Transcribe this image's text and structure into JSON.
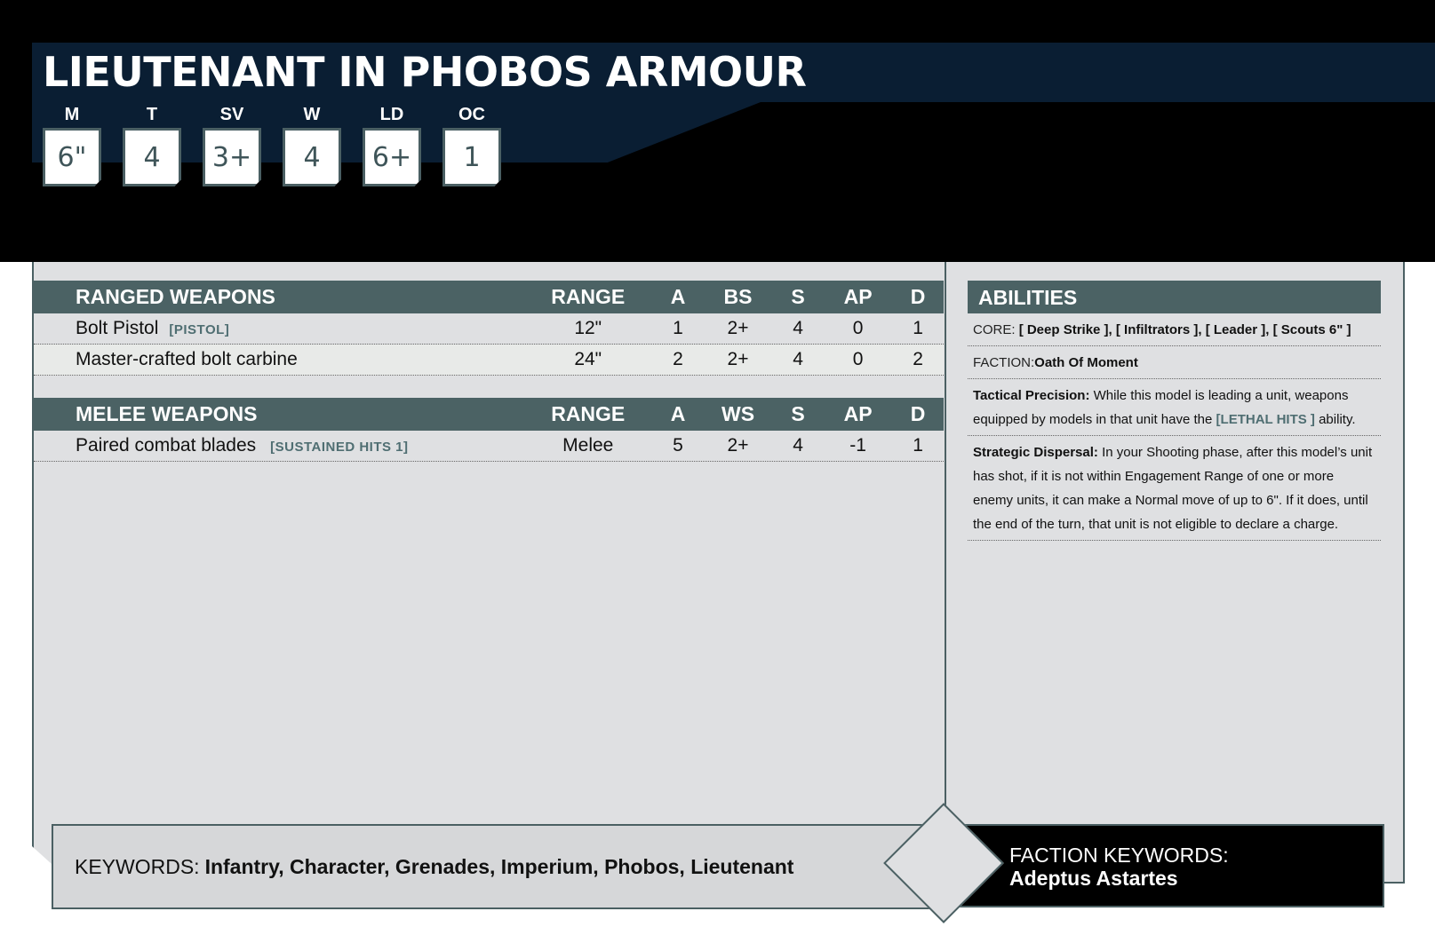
{
  "unit": {
    "title": "LIEUTENANT IN PHOBOS ARMOUR"
  },
  "stats": [
    {
      "label": "M",
      "value": "6\""
    },
    {
      "label": "T",
      "value": "4"
    },
    {
      "label": "SV",
      "value": "3+"
    },
    {
      "label": "W",
      "value": "4"
    },
    {
      "label": "LD",
      "value": "6+"
    },
    {
      "label": "OC",
      "value": "1"
    }
  ],
  "ranged": {
    "header": [
      "RANGED WEAPONS",
      "RANGE",
      "A",
      "BS",
      "S",
      "AP",
      "D"
    ],
    "rows": [
      {
        "name": "Bolt Pistol",
        "tag": "[PISTOL]",
        "range": "12\"",
        "a": "1",
        "skill": "2+",
        "s": "4",
        "ap": "0",
        "d": "1"
      },
      {
        "name": "Master-crafted bolt carbine",
        "tag": "",
        "range": "24\"",
        "a": "2",
        "skill": "2+",
        "s": "4",
        "ap": "0",
        "d": "2"
      }
    ]
  },
  "melee": {
    "header": [
      "MELEE WEAPONS",
      "RANGE",
      "A",
      "WS",
      "S",
      "AP",
      "D"
    ],
    "rows": [
      {
        "name": "Paired combat blades",
        "tag": "[SUSTAINED HITS 1]",
        "range": "Melee",
        "a": "5",
        "skill": "2+",
        "s": "4",
        "ap": "-1",
        "d": "1"
      }
    ]
  },
  "abilities": {
    "header": "ABILITIES",
    "core_prefix": "CORE:",
    "core_value": "[ Deep Strike ], [ Infiltrators ], [ Leader ], [ Scouts 6\" ]",
    "faction_prefix": "FACTION:",
    "faction_value": "Oath Of Moment",
    "tactical_title": "Tactical Precision:",
    "tactical_text": "While this model is leading a unit, weapons equipped by models in that unit have the",
    "tactical_link": "[LETHAL HITS ]",
    "tactical_tail": "ability.",
    "strategic_title": "Strategic Dispersal:",
    "strategic_text": "In your Shooting phase, after this model’s unit has shot, if it is not within Engagement Range of one or more enemy units, it can make a Normal move of up to 6\". If it does, until the end of the turn, that unit is not eligible to declare a charge."
  },
  "keywords": {
    "label": "KEYWORDS:",
    "list": "Infantry, Character, Grenades, Imperium, Phobos, Lieutenant"
  },
  "faction_keywords": {
    "label": "FACTION KEYWORDS:",
    "value": "Adeptus Astartes"
  },
  "colors": {
    "header_black": "#000000",
    "header_navy": "#0a1e33",
    "slate_header": "#4b6264",
    "tag_teal": "#4f6e72",
    "card_grey": "#dfe0e2"
  }
}
